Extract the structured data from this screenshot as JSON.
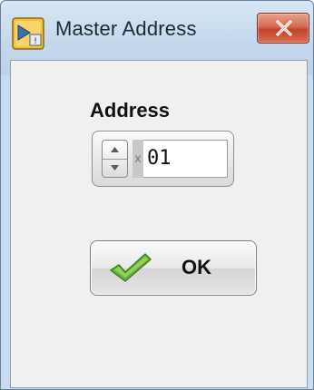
{
  "window": {
    "title": "Master Address",
    "icon": "labview-app-icon",
    "close_icon": "close-icon"
  },
  "address": {
    "label": "Address",
    "radix": "x",
    "value": "01",
    "spinner_icon": "spinner-arrows-icon"
  },
  "ok_button": {
    "label": "OK",
    "icon": "check-icon"
  },
  "colors": {
    "title_bar": "#c3d7ec",
    "client_background": "#f0f0f0",
    "close_button": "#c2432a",
    "check_green": "#6ab53a"
  }
}
